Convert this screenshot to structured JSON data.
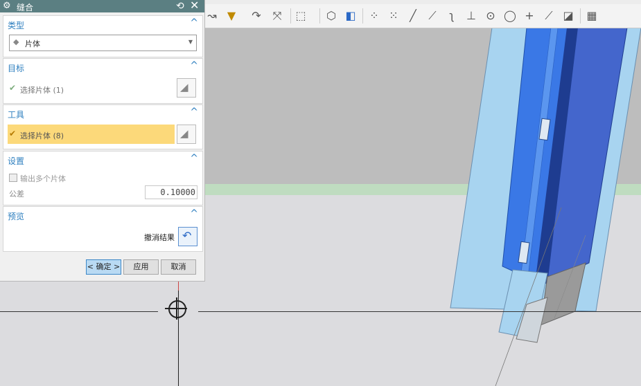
{
  "dialog": {
    "title": "缝合",
    "gear_icon": "gear-icon",
    "reset_glyph": "⟲",
    "close_glyph": "✕",
    "type_section": {
      "header": "类型",
      "selected": "片体"
    },
    "target_section": {
      "header": "目标",
      "select_label": "选择片体 (1)"
    },
    "tool_section": {
      "header": "工具",
      "select_label": "选择片体 (8)"
    },
    "settings_section": {
      "header": "设置",
      "output_multiple_label": "输出多个片体",
      "output_multiple_checked": false,
      "tolerance_label": "公差",
      "tolerance_value": "0.10000"
    },
    "preview_section": {
      "header": "预览",
      "undo_label": "撤消结果"
    },
    "buttons": {
      "ok": "< 确定 >",
      "apply": "应用",
      "cancel": "取消"
    }
  },
  "colors": {
    "title_bar": "#5b7f82",
    "section_header": "#2e7fbf",
    "active_selection": "#fcd97a",
    "model_light_blue": "#a8d4f0",
    "model_blue": "#3a78e6",
    "model_dark_blue": "#2448a8"
  }
}
